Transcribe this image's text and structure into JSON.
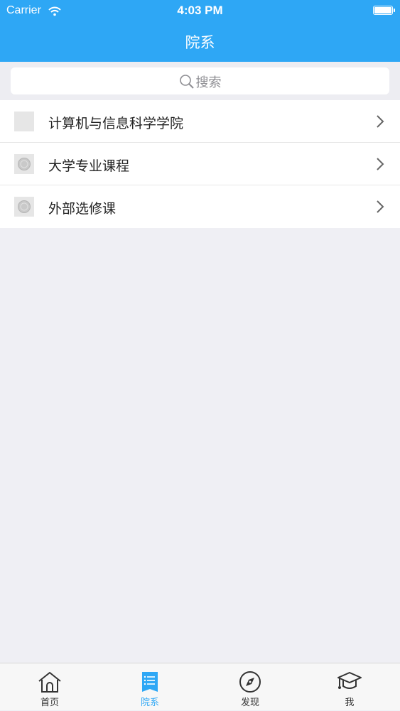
{
  "status_bar": {
    "carrier": "Carrier",
    "time": "4:03 PM"
  },
  "nav": {
    "title": "院系"
  },
  "search": {
    "placeholder": "搜索"
  },
  "departments": [
    {
      "label": "计算机与信息科学学院"
    },
    {
      "label": "大学专业课程"
    },
    {
      "label": "外部选修课"
    }
  ],
  "tabs": [
    {
      "label": "首页",
      "icon": "home-icon",
      "active": false
    },
    {
      "label": "院系",
      "icon": "list-icon",
      "active": true
    },
    {
      "label": "发现",
      "icon": "compass-icon",
      "active": false
    },
    {
      "label": "我",
      "icon": "graduation-cap-icon",
      "active": false
    }
  ],
  "colors": {
    "accent": "#2ea7f5",
    "background": "#efeff4",
    "inactive_tab": "#333333"
  }
}
